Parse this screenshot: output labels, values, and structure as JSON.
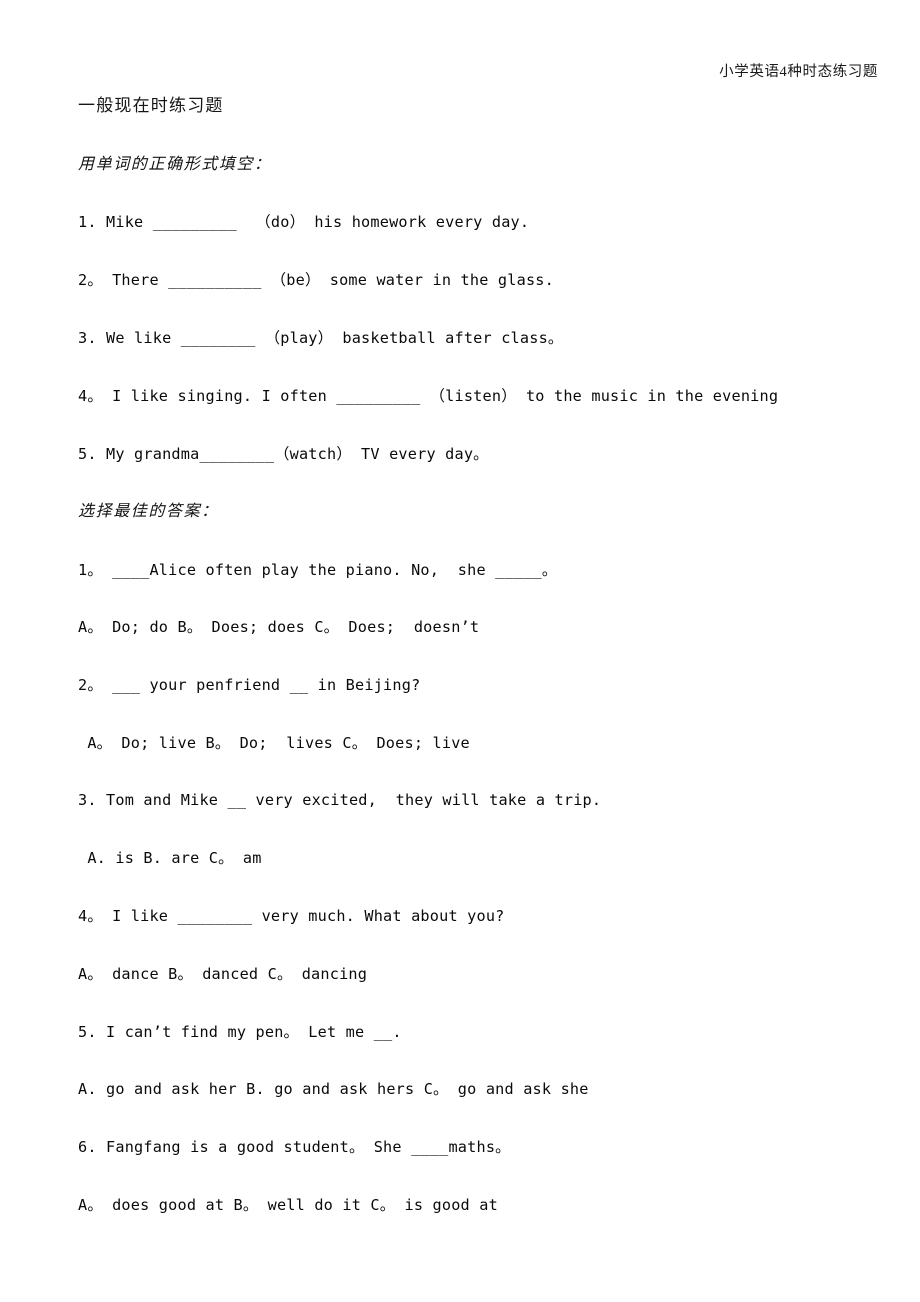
{
  "document": {
    "running_header": "小学英语4种时态练习题",
    "title": "一般现在时练习题"
  },
  "sections": [
    {
      "instruction": "用单词的正确形式填空：",
      "items": [
        "1. Mike _________  （do） his homework every day.",
        "2。 There __________ （be） some water in the glass.",
        "3. We like ________ （play） basketball after class。",
        "4。 I like singing. I often _________ （listen） to the music in the evening",
        "5. My grandma________（watch） TV every day。"
      ]
    },
    {
      "instruction": "选择最佳的答案：",
      "questions": [
        {
          "stem": "1。 ____Alice often play the piano. No,  she _____。",
          "options": "A。 Do; do B。 Does; does C。 Does;  doesn’t"
        },
        {
          "stem": "2。 ___ your penfriend __ in Beijing?",
          "options": " A。 Do; live B。 Do;  lives C。 Does; live"
        },
        {
          "stem": "3. Tom and Mike __ very excited,  they will take a trip.",
          "options": " A. is B. are C。 am"
        },
        {
          "stem": "4。 I like ________ very much. What about you?",
          "options": "A。 dance B。 danced C。 dancing"
        },
        {
          "stem": "5. I can’t find my pen。 Let me __.",
          "options": "A. go and ask her B. go and ask hers C。 go and ask she"
        },
        {
          "stem": "6. Fangfang is a good student。 She ____maths。",
          "options": "A。 does good at B。 well do it C。 is good at"
        }
      ]
    }
  ]
}
